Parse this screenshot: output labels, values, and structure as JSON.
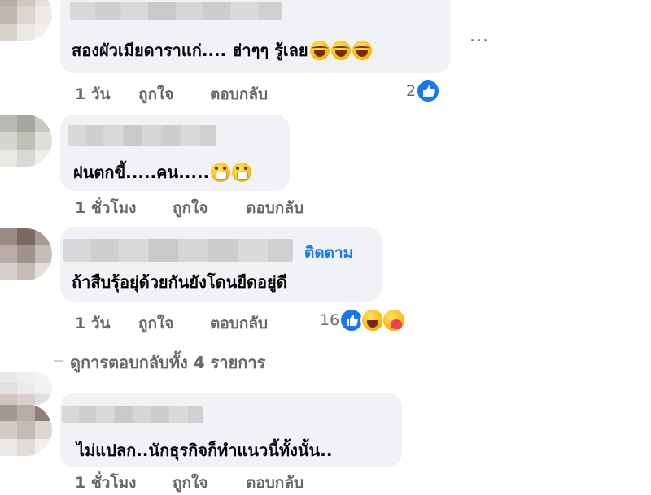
{
  "comments": [
    {
      "text": "สองผัวเมียดาราแก่.... ฮ่าๆๆ รู้เลย",
      "time": "1 วัน",
      "like_label": "ถูกใจ",
      "reply_label": "ตอบกลับ",
      "reaction_count": "2",
      "reactions": [
        "like-icon"
      ],
      "emojis": [
        "grinning-tears-emoji",
        "grinning-tears-emoji",
        "grinning-tears-emoji"
      ]
    },
    {
      "text": "ฝนตกขี้.....คน.....",
      "time": "1 ชั่วโมง",
      "like_label": "ถูกใจ",
      "reply_label": "ตอบกลับ",
      "emojis": [
        "grimacing-emoji",
        "grimacing-emoji"
      ]
    },
    {
      "text": "ถ้าสืบรุ้อยุ่ด้วยกันยังโดนยืดอยู่ดี",
      "follow_label": "ติดตาม",
      "time": "1 วัน",
      "reply_label": "ตอบกลับ",
      "like_label": "ถูกใจ",
      "reaction_count": "16",
      "reactions": [
        "like-icon",
        "haha-icon",
        "care-icon"
      ]
    },
    {
      "text": "ไม่แปลก..นักธุรกิจก็ทำแนวนี้ทั้งนั้น..",
      "time": "1 ชั่วโมง",
      "like_label": "ถูกใจ",
      "reply_label": "ตอบกลับ"
    }
  ],
  "view_replies": "ดูการตอบกลับทั้ง 4 รายการ",
  "more_options": "..."
}
